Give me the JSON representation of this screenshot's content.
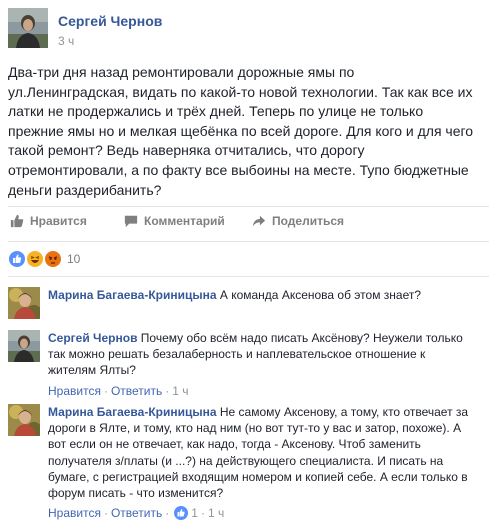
{
  "post": {
    "author": "Сергей Чернов",
    "time": "3 ч",
    "lines": [
      "Два-три дня назад ремонтировали дорожные ямы по",
      "ул.Ленинградская, видать по какой-то новой технологии. Так как все их",
      "латки не продержались и трёх дней. Теперь по улице не только",
      "прежние ямы но и мелкая щебёнка по всей дороге. Для кого и для чего",
      "такой ремонт? Ведь наверняка отчитались, что дорогу",
      "отремонтировали, а по факту все выбоины на месте. Тупо бюджетные",
      "деньги раздерибанить?"
    ]
  },
  "actions": {
    "like": "Нравится",
    "comment": "Комментарий",
    "share": "Поделиться"
  },
  "reactions": {
    "count": "10",
    "icons": [
      "like-icon",
      "haha-icon",
      "angry-icon"
    ],
    "colors": {
      "like": "#5890ff",
      "haha": "#f7b125",
      "angry": "#e9710f"
    }
  },
  "comments": [
    {
      "author": "Марина Багаева-Криницына",
      "lines": [
        "А команда Аксенова об этом знает?"
      ],
      "show_meta": false
    },
    {
      "author": "Сергей Чернов",
      "lines": [
        "Почему обо всём надо писать Аксёнову? Неужели только",
        "так можно решать безалаберность и наплевательское отношение к",
        "жителям Ялты?"
      ],
      "like": "Нравится",
      "reply": "Ответить",
      "time": "1 ч",
      "show_meta": true
    },
    {
      "author": "Марина Багаева-Криницына",
      "lines": [
        "Не самому Аксенову, а тому, кто отвечает за",
        "дороги в Ялте, и тому, кто над ним (но вот тут-то у вас и затор, похоже). А",
        "вот если он не отвечает, как надо, тогда - Аксенову. Чтоб заменить",
        "получателя з/платы (и ...?) на действующего специалиста. И писать на",
        "бумаге, с регистрацией входящим номером и копией себе. А если только в",
        "форум писать - что изменится?"
      ],
      "like": "Нравится",
      "reply": "Ответить",
      "likes": "1",
      "time": "1 ч",
      "show_meta": true
    }
  ],
  "colors": {
    "link": "#365899",
    "meta": "#90949c",
    "action_link": "#4267b2",
    "text": "#1d2129"
  }
}
